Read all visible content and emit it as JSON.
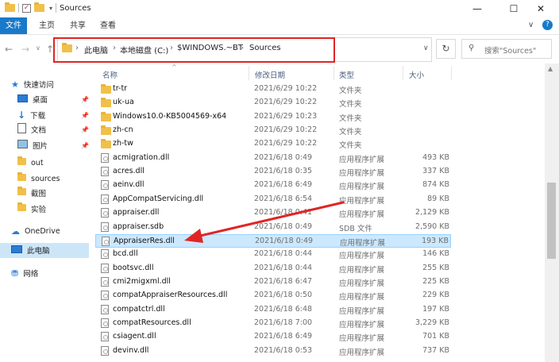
{
  "window": {
    "title": "Sources",
    "controls": {
      "minimize": "—",
      "maximize": "☐",
      "close": "✕"
    },
    "chevron": "∨",
    "help": "?"
  },
  "ribbon": {
    "file": "文件",
    "tabs": [
      "主页",
      "共享",
      "查看"
    ]
  },
  "address": {
    "crumbs": [
      "此电脑",
      "本地磁盘 (C:)",
      "$WINDOWS.~BT",
      "Sources"
    ],
    "dropdown": "∨",
    "refresh": "↻"
  },
  "search": {
    "placeholder": "搜索\"Sources\""
  },
  "nav": {
    "back": "←",
    "forward": "→",
    "recent": "∨",
    "up": "↑"
  },
  "sidebar": {
    "items": [
      {
        "label": "快速访问",
        "icon": "star-icon",
        "pinned": false
      },
      {
        "label": "桌面",
        "icon": "desktop-icon",
        "pinned": true
      },
      {
        "label": "下载",
        "icon": "download-icon",
        "pinned": true
      },
      {
        "label": "文档",
        "icon": "document-icon",
        "pinned": true
      },
      {
        "label": "图片",
        "icon": "picture-icon",
        "pinned": true
      },
      {
        "label": "out",
        "icon": "folder-icon",
        "pinned": false
      },
      {
        "label": "sources",
        "icon": "folder-icon",
        "pinned": false
      },
      {
        "label": "截图",
        "icon": "folder-icon",
        "pinned": false
      },
      {
        "label": "实验",
        "icon": "folder-icon",
        "pinned": false
      },
      {
        "label": "OneDrive",
        "icon": "cloud-icon",
        "pinned": false
      },
      {
        "label": "此电脑",
        "icon": "computer-icon",
        "pinned": false
      },
      {
        "label": "网络",
        "icon": "network-icon",
        "pinned": false
      }
    ]
  },
  "columns": {
    "name": "名称",
    "date": "修改日期",
    "type": "类型",
    "size": "大小",
    "sort_indicator": "^"
  },
  "files": [
    {
      "name": "tr-tr",
      "date": "2021/6/29 10:22",
      "type": "文件夹",
      "size": "",
      "kind": "folder"
    },
    {
      "name": "uk-ua",
      "date": "2021/6/29 10:22",
      "type": "文件夹",
      "size": "",
      "kind": "folder"
    },
    {
      "name": "Windows10.0-KB5004569-x64",
      "date": "2021/6/29 10:23",
      "type": "文件夹",
      "size": "",
      "kind": "folder"
    },
    {
      "name": "zh-cn",
      "date": "2021/6/29 10:22",
      "type": "文件夹",
      "size": "",
      "kind": "folder"
    },
    {
      "name": "zh-tw",
      "date": "2021/6/29 10:22",
      "type": "文件夹",
      "size": "",
      "kind": "folder"
    },
    {
      "name": "acmigration.dll",
      "date": "2021/6/18 0:49",
      "type": "应用程序扩展",
      "size": "493 KB",
      "kind": "file"
    },
    {
      "name": "acres.dll",
      "date": "2021/6/18 0:35",
      "type": "应用程序扩展",
      "size": "337 KB",
      "kind": "file"
    },
    {
      "name": "aeinv.dll",
      "date": "2021/6/18 6:49",
      "type": "应用程序扩展",
      "size": "874 KB",
      "kind": "file"
    },
    {
      "name": "AppCompatServicing.dll",
      "date": "2021/6/18 6:54",
      "type": "应用程序扩展",
      "size": "89 KB",
      "kind": "file"
    },
    {
      "name": "appraiser.dll",
      "date": "2021/6/18 0:41",
      "type": "应用程序扩展",
      "size": "2,129 KB",
      "kind": "file"
    },
    {
      "name": "appraiser.sdb",
      "date": "2021/6/18 0:49",
      "type": "SDB 文件",
      "size": "2,590 KB",
      "kind": "file"
    },
    {
      "name": "AppraiserRes.dll",
      "date": "2021/6/18 0:49",
      "type": "应用程序扩展",
      "size": "193 KB",
      "kind": "file",
      "selected": true
    },
    {
      "name": "bcd.dll",
      "date": "2021/6/18 0:44",
      "type": "应用程序扩展",
      "size": "146 KB",
      "kind": "file"
    },
    {
      "name": "bootsvc.dll",
      "date": "2021/6/18 0:44",
      "type": "应用程序扩展",
      "size": "255 KB",
      "kind": "file"
    },
    {
      "name": "cmi2migxml.dll",
      "date": "2021/6/18 6:47",
      "type": "应用程序扩展",
      "size": "225 KB",
      "kind": "file"
    },
    {
      "name": "compatAppraiserResources.dll",
      "date": "2021/6/18 0:50",
      "type": "应用程序扩展",
      "size": "229 KB",
      "kind": "file"
    },
    {
      "name": "compatctrl.dll",
      "date": "2021/6/18 6:48",
      "type": "应用程序扩展",
      "size": "197 KB",
      "kind": "file"
    },
    {
      "name": "compatResources.dll",
      "date": "2021/6/18 7:00",
      "type": "应用程序扩展",
      "size": "3,229 KB",
      "kind": "file"
    },
    {
      "name": "csiagent.dll",
      "date": "2021/6/18 6:49",
      "type": "应用程序扩展",
      "size": "701 KB",
      "kind": "file"
    },
    {
      "name": "devinv.dll",
      "date": "2021/6/18 0:53",
      "type": "应用程序扩展",
      "size": "737 KB",
      "kind": "file"
    }
  ],
  "colors": {
    "accent": "#1979ca",
    "highlight_box": "#e02525",
    "arrow": "#e02525",
    "selection": "#cce8ff"
  }
}
